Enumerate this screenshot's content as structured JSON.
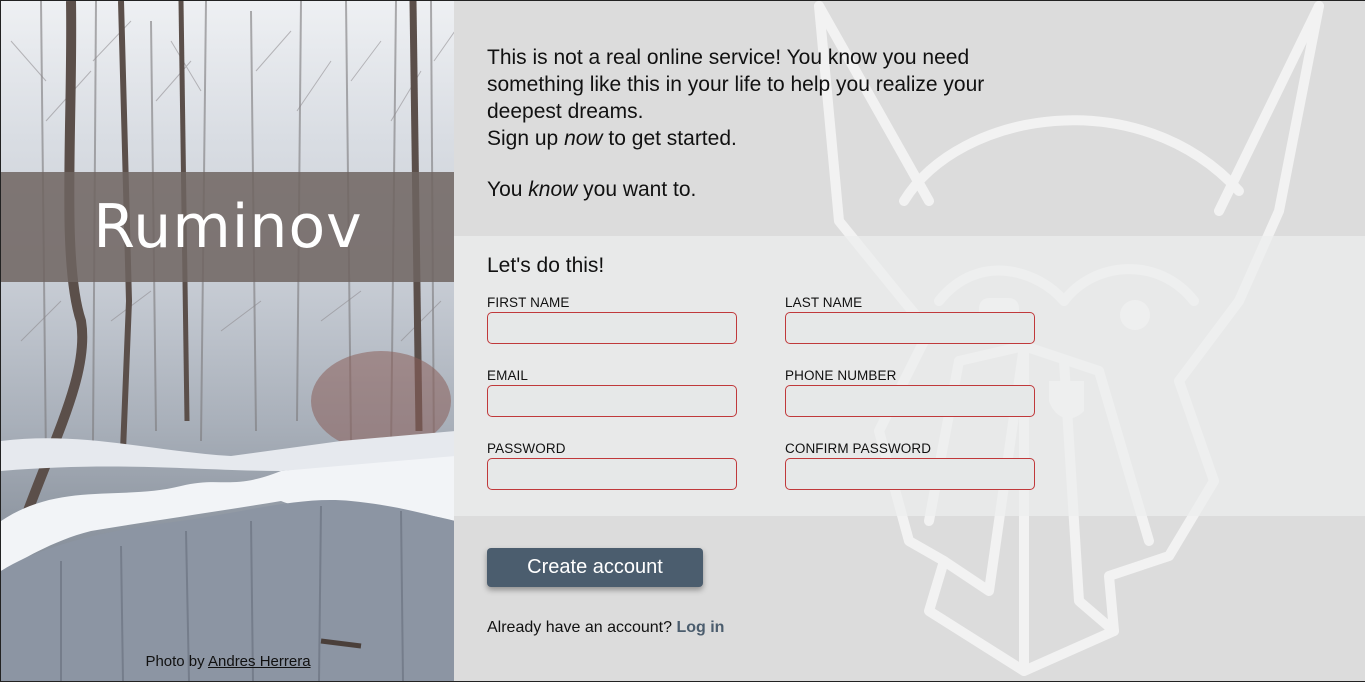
{
  "brand": {
    "title": "Ruminov",
    "credit_prefix": "Photo by ",
    "credit_author": "Andres Herrera"
  },
  "intro": {
    "line1": "This is not a real online service! You know you need something like this in your life to help you realize your deepest dreams.",
    "line2_pre": "Sign up ",
    "line2_em": "now",
    "line2_post": " to get started.",
    "line3_pre": "You ",
    "line3_em": "know",
    "line3_post": " you want to."
  },
  "form": {
    "heading": "Let's do this!",
    "fields": {
      "first_name": "FIRST NAME",
      "last_name": "LAST NAME",
      "email": "EMAIL",
      "phone": "PHONE NUMBER",
      "password": "PASSWORD",
      "confirm_password": "CONFIRM PASSWORD"
    },
    "values": {
      "first_name": "",
      "last_name": "",
      "email": "",
      "phone": "",
      "password": "",
      "confirm_password": ""
    },
    "submit_label": "Create account",
    "login_prompt": "Already have an account? ",
    "login_link": "Log in"
  },
  "colors": {
    "invalid_border": "#c0393b",
    "button_bg": "#4b5d6e",
    "brand_band": "#6e6460"
  },
  "icons": {
    "mascot": "viking-mascot-outline"
  }
}
